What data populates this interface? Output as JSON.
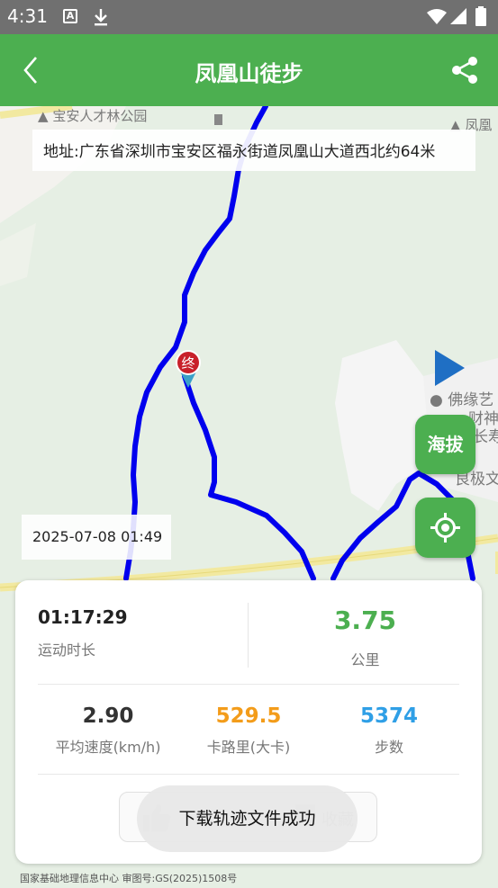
{
  "status_bar": {
    "time": "4:31",
    "a_icon": "A"
  },
  "app_bar": {
    "title": "凤凰山徒步"
  },
  "map": {
    "pois": {
      "talent_park": "宝安人才林公园",
      "phoenix": "凤凰",
      "foyuan": "佛缘艺",
      "caishen": "财神",
      "changshou": "长寿",
      "liangji": "良极文"
    },
    "address": "地址:广东省深圳市宝安区福永街道凤凰山大道西北约64米",
    "timestamp": "2025-07-08 01:49",
    "end_marker_label": "终",
    "altitude_label": "海拔",
    "footer": "国家基础地理信息中心 审图号:GS(2025)1508号",
    "route_color": "#0000ee"
  },
  "stats": {
    "duration_value": "01:17:29",
    "duration_label": "运动时长",
    "distance_value": "3.75",
    "distance_label": "公里",
    "avg_speed_value": "2.90",
    "avg_speed_label": "平均速度(km/h)",
    "calories_value": "529.5",
    "calories_label": "卡路里(大卡)",
    "steps_value": "5374",
    "steps_label": "步数",
    "favorite_label": "收藏",
    "colors": {
      "distance": "#4caf50",
      "calories": "#f39c1a",
      "steps": "#2f9fe6"
    }
  },
  "toast": {
    "message": "下载轨迹文件成功"
  }
}
